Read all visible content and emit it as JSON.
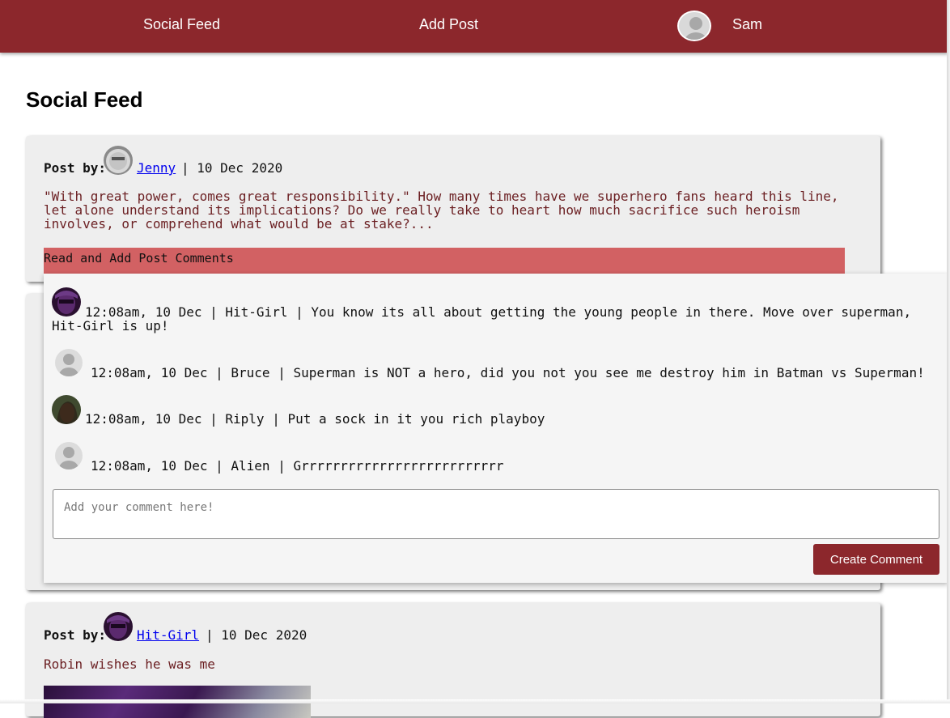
{
  "nav": {
    "feed_label": "Social Feed",
    "add_post_label": "Add Post",
    "user_name": "Sam"
  },
  "page": {
    "title": "Social Feed"
  },
  "posts": [
    {
      "label": "Post by:",
      "author": "Jenny",
      "date": "| 10 Dec 2020",
      "body": "\"With great power, comes great responsibility.\" How many times have we superhero fans heard this line, let alone understand its implications? Do we really take to heart how much sacrifice such heroism involves, or comprehend what would be at stake?...",
      "comments_toggle": "Read and Add Post Comments"
    },
    {
      "label": "Post by:",
      "author": "Hit-Girl",
      "date": "| 10 Dec 2020",
      "body": "Robin wishes he was me"
    }
  ],
  "comments": [
    {
      "text": "12:08am, 10 Dec | Hit-Girl | You know its all about getting the young people in there. Move over superman, Hit-Girl is up!",
      "avatar": "hit-girl-avatar"
    },
    {
      "text": "12:08am, 10 Dec | Bruce | Superman is NOT a hero, did you not you see me destroy him in Batman vs Superman!",
      "avatar": "default-avatar"
    },
    {
      "text": "12:08am, 10 Dec | Riply | Put a sock in it you rich playboy",
      "avatar": "riply-avatar"
    },
    {
      "text": "12:08am, 10 Dec | Alien | Grrrrrrrrrrrrrrrrrrrrrrrrrr",
      "avatar": "default-avatar"
    }
  ],
  "comment_form": {
    "placeholder": "Add your comment here!",
    "submit_label": "Create Comment"
  },
  "colors": {
    "brand": "#8c272c",
    "toggle_bar": "#d26163",
    "post_text": "#6b1f22",
    "card_bg": "#eeeeee"
  }
}
